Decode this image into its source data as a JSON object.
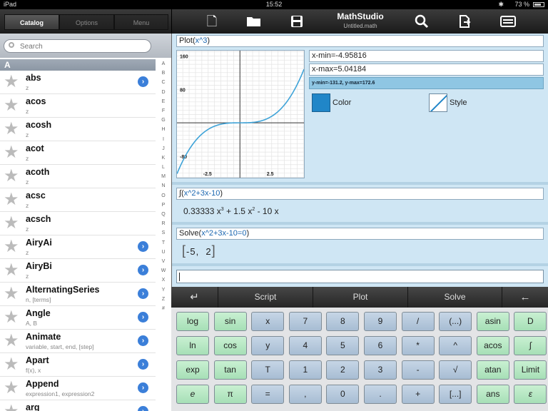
{
  "status": {
    "carrier": "iPad",
    "time": "15:52",
    "battery": "73 %"
  },
  "sidebar": {
    "tabs": [
      "Catalog",
      "Options",
      "Menu"
    ],
    "search_placeholder": "Search",
    "section": "A",
    "items": [
      {
        "name": "abs",
        "args": "z",
        "info": true
      },
      {
        "name": "acos",
        "args": "z",
        "info": false
      },
      {
        "name": "acosh",
        "args": "z",
        "info": false
      },
      {
        "name": "acot",
        "args": "z",
        "info": false
      },
      {
        "name": "acoth",
        "args": "z",
        "info": false
      },
      {
        "name": "acsc",
        "args": "z",
        "info": false
      },
      {
        "name": "acsch",
        "args": "z",
        "info": false
      },
      {
        "name": "AiryAi",
        "args": "z",
        "info": true
      },
      {
        "name": "AiryBi",
        "args": "z",
        "info": true
      },
      {
        "name": "AlternatingSeries",
        "args": "n, [terms]",
        "info": true
      },
      {
        "name": "Angle",
        "args": "A, B",
        "info": true
      },
      {
        "name": "Animate",
        "args": "variable, start, end, [step]",
        "info": true
      },
      {
        "name": "Apart",
        "args": "f(x), x",
        "info": true
      },
      {
        "name": "Append",
        "args": "expression1, expression2",
        "info": true
      },
      {
        "name": "arg",
        "args": "",
        "info": true
      }
    ],
    "index_letters": [
      "A",
      "B",
      "C",
      "D",
      "E",
      "F",
      "G",
      "H",
      "I",
      "J",
      "K",
      "L",
      "M",
      "N",
      "O",
      "P",
      "Q",
      "R",
      "S",
      "T",
      "U",
      "V",
      "W",
      "X",
      "Y",
      "Z",
      "#"
    ]
  },
  "toolbar": {
    "title": "MathStudio",
    "document": "Untitled.math"
  },
  "worksheet": {
    "plot_cmd": {
      "prefix": "Plot(",
      "expr": "x^3",
      "suffix": ")"
    },
    "xmin": "x-min=-4.95816",
    "xmax": "x-max=5.04184",
    "yrange": "y-min=-131.2, y-max=172.6",
    "color_label": "Color",
    "style_label": "Style",
    "integral_cmd": {
      "prefix": "∫(",
      "expr": "x^2+3x-10",
      "suffix": ")"
    },
    "integral_result": {
      "t1": "0.33333 x",
      "e1": "3",
      "t2": " + 1.5 x",
      "e2": "2",
      "t3": " - 10 x"
    },
    "solve_cmd": {
      "prefix": "Solve(",
      "expr": "x^2+3x-10=0",
      "suffix": ")"
    },
    "solve_result": {
      "a": "-5",
      "b": "2"
    },
    "input": ""
  },
  "chart_data": {
    "type": "line",
    "series": [
      {
        "function": "x^3",
        "color": "#3ea3d8"
      }
    ],
    "xlim": [
      -4.95816,
      5.04184
    ],
    "ylim": [
      -131.2,
      172.6
    ],
    "x_ticks": [
      "-2.5",
      "2.5"
    ],
    "y_ticks": [
      "160",
      "80",
      "-80"
    ],
    "grid": true
  },
  "keypad": {
    "header": [
      "↵",
      "Script",
      "Plot",
      "Solve",
      "←"
    ],
    "rows": [
      [
        [
          "log",
          "g"
        ],
        [
          "sin",
          "g"
        ],
        [
          "x",
          "b"
        ],
        [
          "7",
          "b"
        ],
        [
          "8",
          "b"
        ],
        [
          "9",
          "b"
        ],
        [
          "/",
          "b"
        ],
        [
          "(...)",
          "b"
        ],
        [
          "asin",
          "g"
        ],
        [
          "D",
          "g"
        ]
      ],
      [
        [
          "ln",
          "g"
        ],
        [
          "cos",
          "g"
        ],
        [
          "y",
          "b"
        ],
        [
          "4",
          "b"
        ],
        [
          "5",
          "b"
        ],
        [
          "6",
          "b"
        ],
        [
          "*",
          "b"
        ],
        [
          "^",
          "b"
        ],
        [
          "acos",
          "g"
        ],
        [
          "∫",
          "g"
        ]
      ],
      [
        [
          "exp",
          "g"
        ],
        [
          "tan",
          "g"
        ],
        [
          "T",
          "b"
        ],
        [
          "1",
          "b"
        ],
        [
          "2",
          "b"
        ],
        [
          "3",
          "b"
        ],
        [
          "-",
          "b"
        ],
        [
          "√",
          "b"
        ],
        [
          "atan",
          "g"
        ],
        [
          "Limit",
          "g"
        ]
      ],
      [
        [
          "e",
          "g"
        ],
        [
          "π",
          "g"
        ],
        [
          "=",
          "b"
        ],
        [
          ",",
          "b"
        ],
        [
          "0",
          "b"
        ],
        [
          ".",
          "b"
        ],
        [
          "+",
          "b"
        ],
        [
          "[...]",
          "b"
        ],
        [
          "ans",
          "g"
        ],
        [
          "ε",
          "g"
        ]
      ]
    ]
  }
}
